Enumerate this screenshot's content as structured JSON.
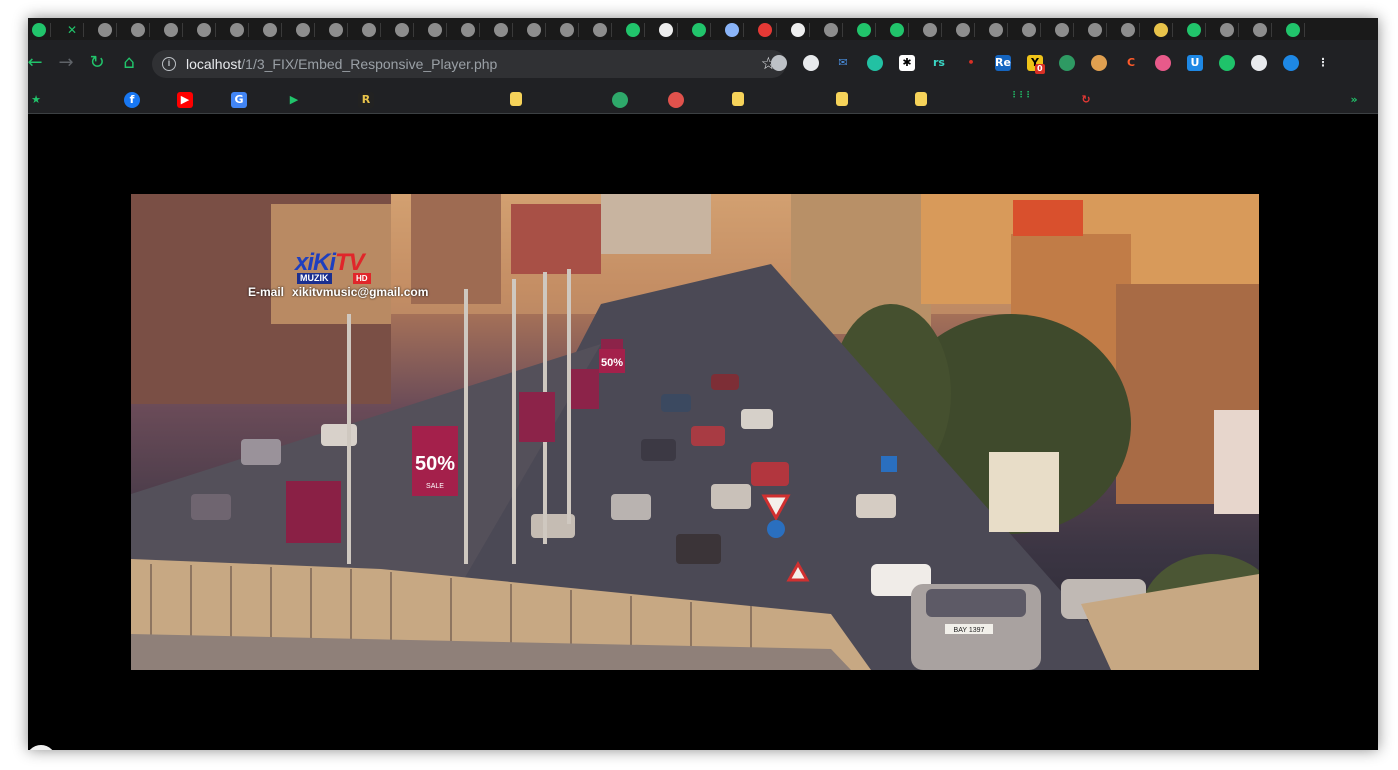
{
  "browser": {
    "address_host": "localhost",
    "address_path": "/1/3_FIX/Embed_Responsive_Player.php",
    "tabs": [
      "green",
      "x",
      "gray",
      "gray",
      "gray",
      "gray",
      "gray",
      "gray",
      "gray",
      "gray",
      "gray",
      "gray",
      "gray",
      "gray",
      "gray",
      "gray",
      "gray",
      "gray",
      "green",
      "white",
      "green",
      "lightblue",
      "red",
      "white",
      "gray",
      "green",
      "green",
      "gray",
      "gray",
      "gray",
      "gray",
      "gray",
      "gray",
      "gray",
      "yellow",
      "green",
      "gray",
      "gray",
      "green"
    ],
    "extensions": [
      {
        "icon": "globe-icon",
        "label": "",
        "color": "#bdc1c6"
      },
      {
        "icon": "bus-icon",
        "label": "",
        "color": "#e8eaed"
      },
      {
        "icon": "mail-icon",
        "label": "✉",
        "color": "#4a90e2"
      },
      {
        "icon": "robot-icon",
        "label": "",
        "color": "#22c1a3"
      },
      {
        "icon": "asterisk-icon",
        "label": "✱",
        "color": "#ffffff"
      },
      {
        "icon": "rs-icon",
        "label": "rs",
        "color": "#3ad6c5"
      },
      {
        "icon": "red-dot-icon",
        "label": "•",
        "color": "#d93025"
      },
      {
        "icon": "re-icon",
        "label": "Re",
        "color": "#1565c0"
      },
      {
        "icon": "y-badge-icon",
        "label": "Y",
        "color": "#f0c419",
        "badge": "0"
      },
      {
        "icon": "earth-icon",
        "label": "",
        "color": "#2e9a63"
      },
      {
        "icon": "coffee-icon",
        "label": "",
        "color": "#e0a050"
      },
      {
        "icon": "ci-icon",
        "label": "C",
        "color": "#ff5a2a"
      },
      {
        "icon": "pen-icon",
        "label": "",
        "color": "#e85a8a"
      },
      {
        "icon": "u-icon",
        "label": "U",
        "color": "#1e88e5"
      },
      {
        "icon": "puzzle-icon",
        "label": "",
        "color": "#1fc36a"
      },
      {
        "icon": "playlist-icon",
        "label": "",
        "color": "#e8eaed"
      },
      {
        "icon": "target-icon",
        "label": "",
        "color": "#1e88e5"
      },
      {
        "icon": "menu-dots-icon",
        "label": "⋮",
        "color": "#e8eaed"
      }
    ],
    "bookmarks": [
      {
        "icon": "star-bookmark-icon",
        "label": "★",
        "color": "#21c46b"
      },
      {
        "icon": "facebook-icon",
        "label": "f",
        "color": "#1877f2"
      },
      {
        "icon": "youtube-icon",
        "label": "▶",
        "color": "#ff0000"
      },
      {
        "icon": "translate-icon",
        "label": "G",
        "color": "#4285f4"
      },
      {
        "icon": "play-green-icon",
        "label": "▶",
        "color": "#21c46b"
      },
      {
        "icon": "r-icon",
        "label": "R",
        "color": "#e8c34a"
      },
      {
        "icon": "note-icon",
        "label": "",
        "color": "#f6d35a"
      },
      {
        "icon": "earth-green-icon",
        "label": "",
        "color": "#2ea86a"
      },
      {
        "icon": "flower-icon",
        "label": "",
        "color": "#e0524c"
      },
      {
        "icon": "note-icon",
        "label": "",
        "color": "#f6d35a"
      },
      {
        "icon": "note-icon",
        "label": "",
        "color": "#f6d35a"
      },
      {
        "icon": "note-icon",
        "label": "",
        "color": "#f6d35a"
      },
      {
        "icon": "grid-icon",
        "label": "⋮⋮⋮",
        "color": "#21c46b"
      },
      {
        "icon": "refresh-red-icon",
        "label": "↻",
        "color": "#e53935"
      },
      {
        "icon": "more-bookmarks-icon",
        "label": "»",
        "color": "#21c46b"
      }
    ]
  },
  "player": {
    "logo_main": "xiKi",
    "logo_accent": "TV",
    "logo_muzik": "MUZIK",
    "logo_hd": "HD",
    "email_label": "E-mail",
    "email_value": "xikitvmusic@gmail.com",
    "sign_sale_percent": "50%",
    "sign_sale_word": "SALE",
    "sign_sale_percent_small": "50%",
    "plate": "BAY 1397"
  }
}
